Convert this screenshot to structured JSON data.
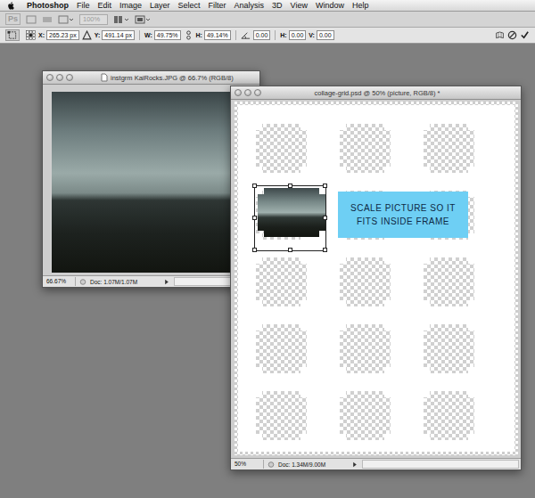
{
  "menu_bar": {
    "app": "Photoshop",
    "items": [
      "File",
      "Edit",
      "Image",
      "Layer",
      "Select",
      "Filter",
      "Analysis",
      "3D",
      "View",
      "Window",
      "Help"
    ]
  },
  "app_bar": {
    "logo": "Ps",
    "zoom": "100%",
    "zoom_disabled": true
  },
  "options_bar": {
    "fields": [
      {
        "kind": "position",
        "label": "X:",
        "value": "265.23 px"
      },
      {
        "kind": "position",
        "label": "Y:",
        "value": "491.14 px"
      },
      {
        "kind": "scale",
        "label": "W:",
        "value": "49.75%"
      },
      {
        "kind": "scale",
        "label": "H:",
        "value": "49.14%"
      },
      {
        "kind": "angle",
        "value": "0.00"
      },
      {
        "kind": "skew",
        "label": "H:",
        "value": "0.00"
      },
      {
        "kind": "skew",
        "label": "V:",
        "value": "0.00"
      }
    ]
  },
  "windows": [
    {
      "kind": "photo",
      "title": "instgrm KaiRocks.JPG @ 66.7% (RGB/8)",
      "zoom": "66.67%",
      "doc": "Doc: 1.07M/1.07M",
      "active": false
    },
    {
      "kind": "canvas",
      "title": "collage-grid.psd @ 50% (picture, RGB/8) *",
      "zoom": "50%",
      "doc": "Doc: 1.34M/9.00M",
      "active": true
    }
  ],
  "canvas": {
    "frames": [
      {
        "selected": false
      },
      {
        "selected": false
      },
      {
        "selected": false
      },
      {
        "selected": true
      },
      {
        "selected": false
      },
      {
        "selected": false
      },
      {
        "selected": false
      },
      {
        "selected": false
      },
      {
        "selected": false
      },
      {
        "selected": false
      },
      {
        "selected": false
      },
      {
        "selected": false
      },
      {
        "selected": false
      },
      {
        "selected": false
      },
      {
        "selected": false
      }
    ],
    "callout": {
      "text": "SCALE PICTURE SO IT FITS INSIDE FRAME"
    }
  }
}
